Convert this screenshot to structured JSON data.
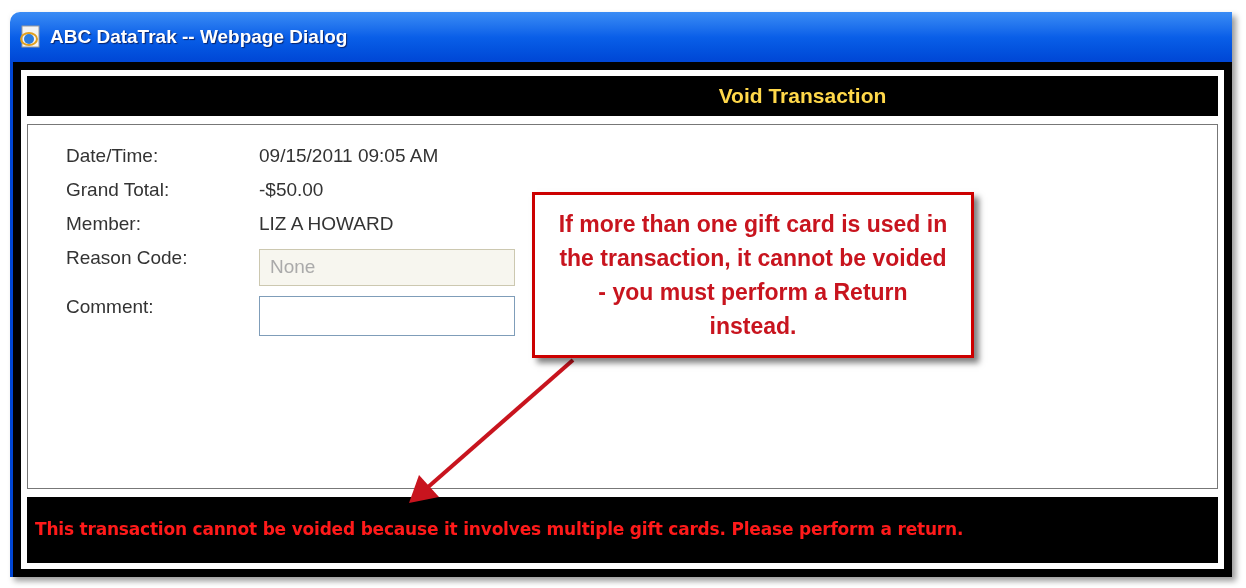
{
  "window": {
    "title": "ABC DataTrak -- Webpage Dialog"
  },
  "header": {
    "title": "Void Transaction"
  },
  "fields": [
    {
      "label": "Date/Time:",
      "kind": "text",
      "value": "09/15/2011 09:05 AM"
    },
    {
      "label": "Grand Total:",
      "kind": "text",
      "value": "-$50.00"
    },
    {
      "label": "Member:",
      "kind": "text",
      "value": "LIZ A HOWARD"
    },
    {
      "label": "Reason Code:",
      "kind": "select",
      "placeholder": "None",
      "disabled": true
    },
    {
      "label": "Comment:",
      "kind": "input"
    }
  ],
  "error_message": "This transaction cannot be voided because it involves multiple gift cards. Please perform a return.",
  "callout": {
    "text": "If more than one gift card is used in the transaction, it cannot be voided - you must perform a Return instead."
  }
}
